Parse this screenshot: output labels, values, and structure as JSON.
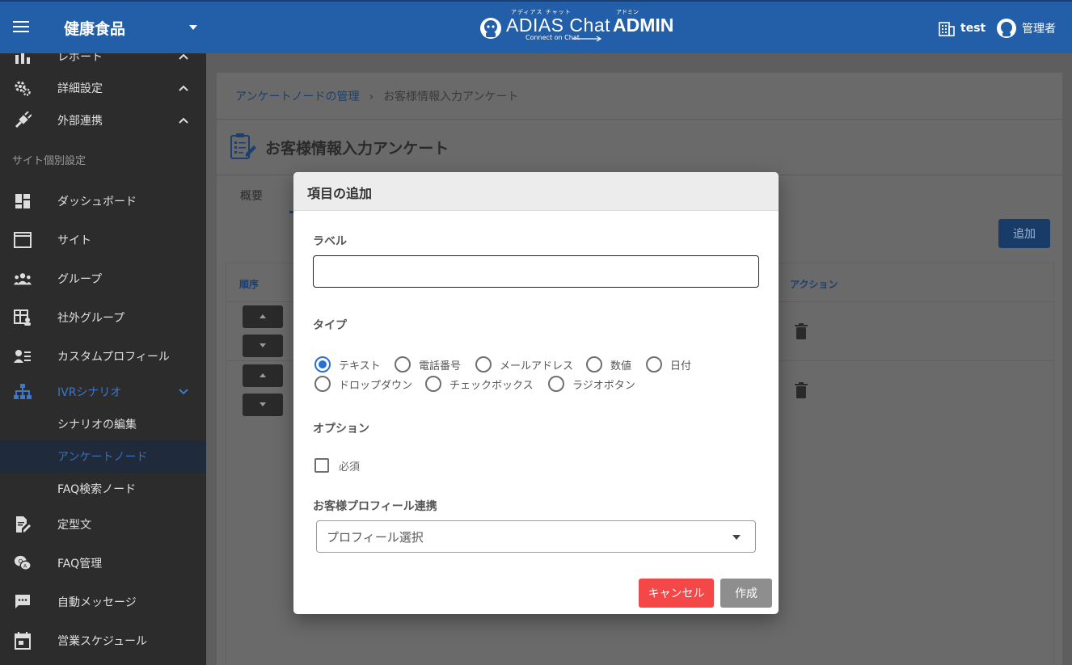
{
  "header": {
    "store_name": "健康食品",
    "logo": {
      "ruby_left": "アディアス チャット",
      "brand": "ADIAS Chat",
      "ruby_right": "アドミン",
      "admin": "ADMIN",
      "sub": "Connect on Chat"
    },
    "store_label": "test",
    "user_label": "管理者"
  },
  "sidebar": {
    "top_items": [
      {
        "label": "レポート",
        "icon": "bar-chart-icon"
      },
      {
        "label": "詳細設定",
        "icon": "gears-icon"
      },
      {
        "label": "外部連携",
        "icon": "plug-icon"
      }
    ],
    "section_label": "サイト個別設定",
    "items": [
      {
        "label": "ダッシュボード",
        "icon": "dashboard-icon"
      },
      {
        "label": "サイト",
        "icon": "window-icon"
      },
      {
        "label": "グループ",
        "icon": "group-icon"
      },
      {
        "label": "社外グループ",
        "icon": "table-person-icon"
      },
      {
        "label": "カスタムプロフィール",
        "icon": "profile-list-icon"
      },
      {
        "label": "IVRシナリオ",
        "icon": "sitemap-icon"
      },
      {
        "label": "シナリオの編集"
      },
      {
        "label": "アンケートノード"
      },
      {
        "label": "FAQ検索ノード"
      },
      {
        "label": "定型文",
        "icon": "document-edit-icon"
      },
      {
        "label": "FAQ管理",
        "icon": "faq-icon"
      },
      {
        "label": "自動メッセージ",
        "icon": "chat-icon"
      },
      {
        "label": "営業スケジュール",
        "icon": "calendar-icon"
      }
    ]
  },
  "main": {
    "breadcrumb": {
      "link": "アンケートノードの管理",
      "separator": "›",
      "current": "お客様情報入力アンケート"
    },
    "page_title": "お客様情報入力アンケート",
    "tab_label": "概要",
    "add_button": "追加",
    "table": {
      "col_order": "順序",
      "col_action": "アクション"
    }
  },
  "dialog": {
    "title": "項目の追加",
    "label_field": {
      "label": "ラベル",
      "value": "",
      "placeholder": ""
    },
    "type_label": "タイプ",
    "types": [
      "テキスト",
      "電話番号",
      "メールアドレス",
      "数値",
      "日付",
      "ドロップダウン",
      "チェックボックス",
      "ラジオボタン"
    ],
    "selected_type": "テキスト",
    "option_label": "オプション",
    "required_label": "必須",
    "required_checked": false,
    "profile_link_label": "お客様プロフィール連携",
    "profile_select_value": "プロフィール選択",
    "cancel_button": "キャンセル",
    "create_button": "作成"
  },
  "colors": {
    "header_bg": "#235fa8",
    "sidebar_bg": "#2c2c2c",
    "accent": "#2a6fd1",
    "cancel": "#f44848",
    "create": "#8e8e8e"
  }
}
